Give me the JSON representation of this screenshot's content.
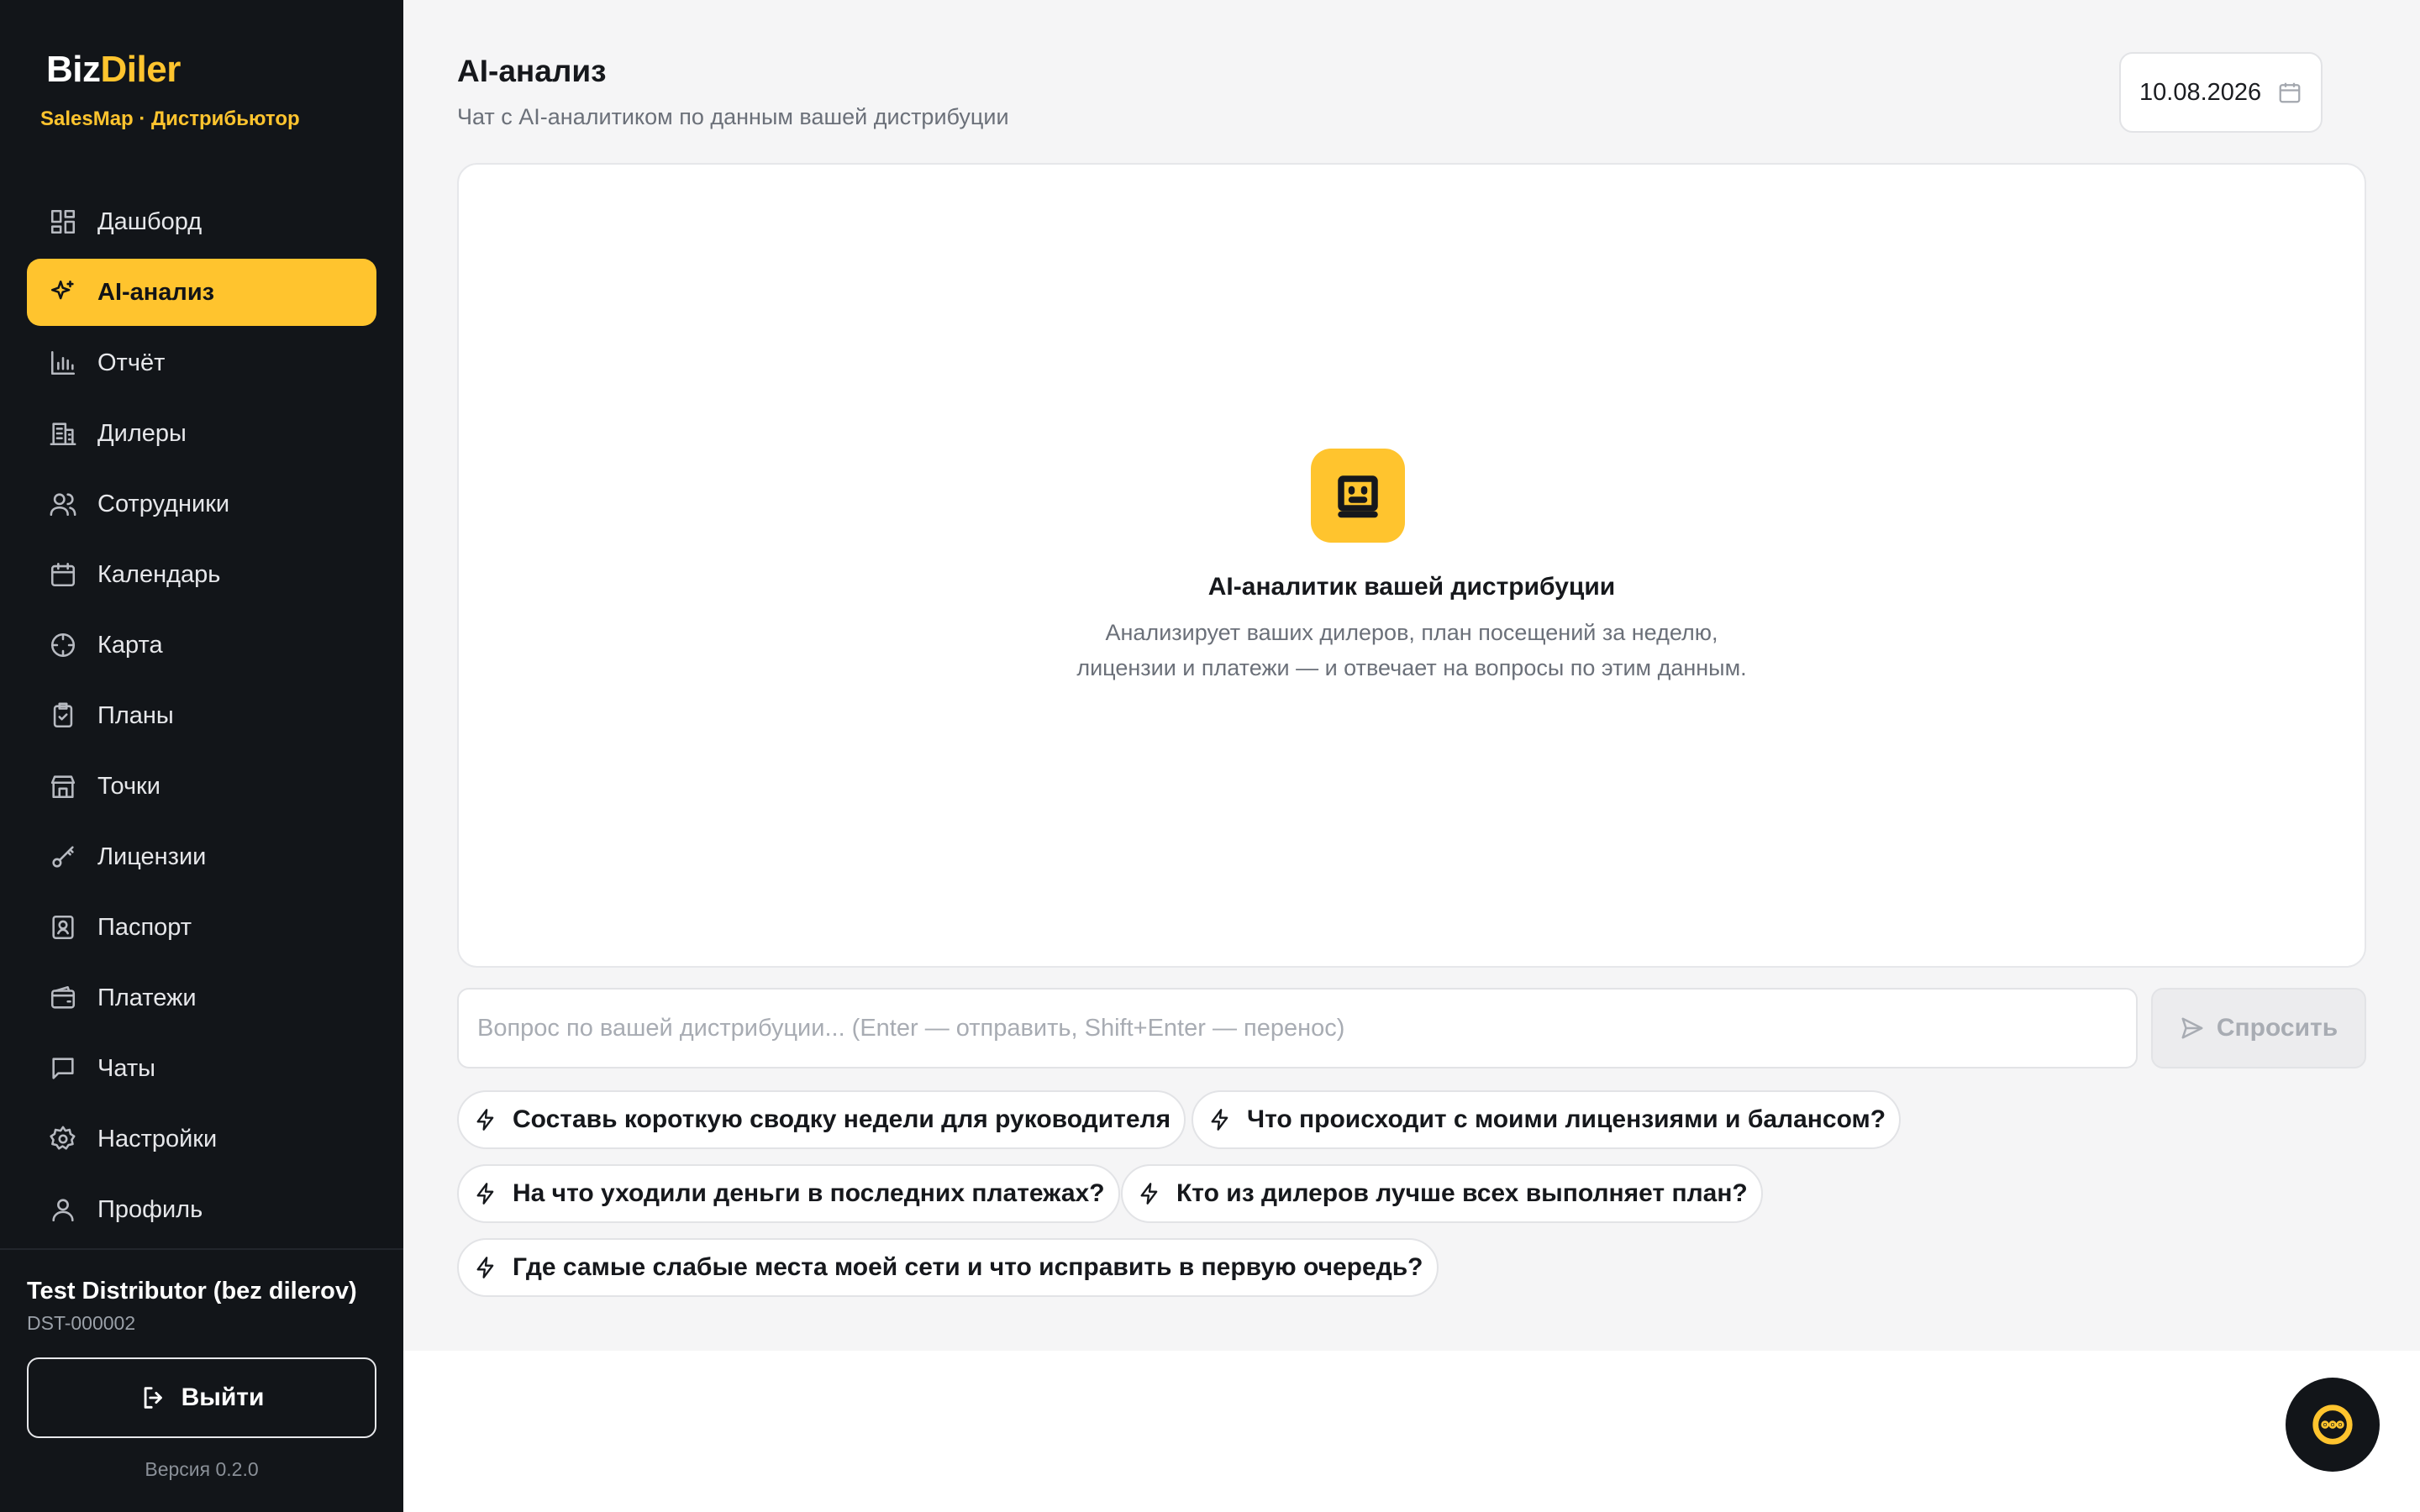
{
  "colors": {
    "accent": "#ffc42e",
    "sidebar_bg": "#121519",
    "main_bg": "#f5f5f6"
  },
  "sidebar": {
    "brand_part1": "Biz",
    "brand_part2": "Diler",
    "brand_sub": "SalesMap · Дистрибьютор",
    "items": [
      {
        "label": "Дашборд",
        "icon": "dashboard-icon"
      },
      {
        "label": "AI-анализ",
        "icon": "sparkle-icon",
        "active": true
      },
      {
        "label": "Отчёт",
        "icon": "chart-icon"
      },
      {
        "label": "Дилеры",
        "icon": "building-icon"
      },
      {
        "label": "Сотрудники",
        "icon": "users-icon"
      },
      {
        "label": "Календарь",
        "icon": "calendar-icon"
      },
      {
        "label": "Карта",
        "icon": "crosshair-icon"
      },
      {
        "label": "Планы",
        "icon": "clipboard-icon"
      },
      {
        "label": "Точки",
        "icon": "store-icon"
      },
      {
        "label": "Лицензии",
        "icon": "key-icon"
      },
      {
        "label": "Паспорт",
        "icon": "id-card-icon"
      },
      {
        "label": "Платежи",
        "icon": "wallet-icon"
      },
      {
        "label": "Чаты",
        "icon": "chat-icon"
      },
      {
        "label": "Настройки",
        "icon": "gear-icon"
      },
      {
        "label": "Профиль",
        "icon": "user-icon"
      }
    ],
    "user_name": "Test Distributor (bez dilerov)",
    "user_id": "DST-000002",
    "logout_label": "Выйти",
    "version": "Версия 0.2.0"
  },
  "header": {
    "title": "AI-анализ",
    "subtitle": "Чат с AI-аналитиком по данным вашей дистрибуции",
    "date": "10.08.2026"
  },
  "empty_state": {
    "title": "AI-аналитик вашей дистрибуции",
    "desc_line1": "Анализирует ваших дилеров, план посещений за неделю,",
    "desc_line2": "лицензии и платежи — и отвечает на вопросы по этим данным."
  },
  "input": {
    "placeholder": "Вопрос по вашей дистрибуции... (Enter — отправить, Shift+Enter — перенос)",
    "ask_label": "Спросить"
  },
  "suggestions": [
    "Составь короткую сводку недели для руководителя",
    "Что происходит с моими лицензиями и балансом?",
    "На что уходили деньги в последних платежах?",
    "Кто из дилеров лучше всех выполняет план?",
    "Где самые слабые места моей сети и что исправить в первую очередь?"
  ]
}
